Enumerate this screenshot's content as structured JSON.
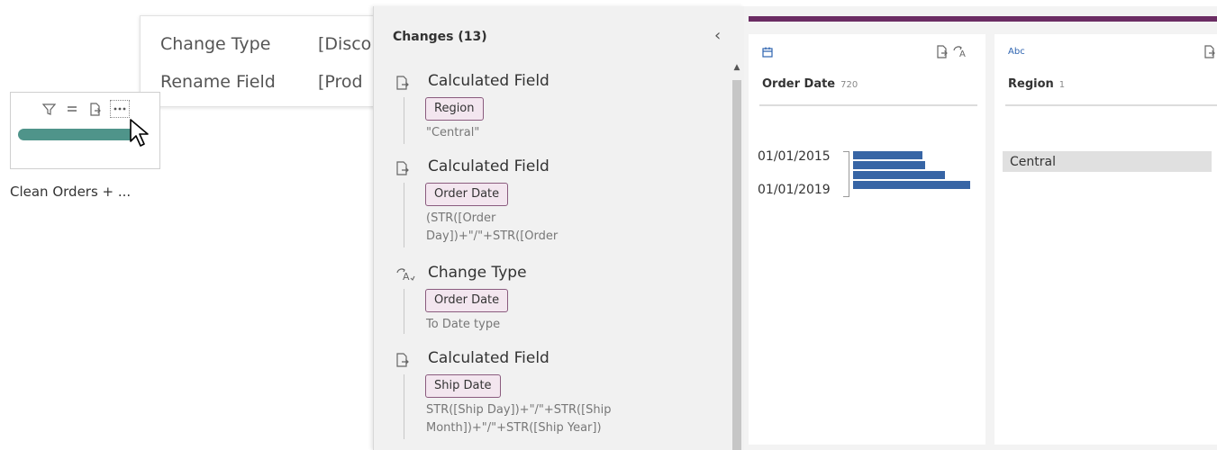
{
  "context_menu": {
    "items": [
      {
        "label": "Change Type",
        "value": "[Disco"
      },
      {
        "label": "Rename Field",
        "value": "[Prod"
      }
    ]
  },
  "flow_node": {
    "label": "Clean Orders + ...",
    "toolbar_icons": [
      "filter-icon",
      "equals-icon",
      "calculated-field-icon",
      "more-options-icon"
    ],
    "accent_color": "#4f948a"
  },
  "changes_panel": {
    "title": "Changes (13)",
    "collapse_glyph": "‹",
    "entries": [
      {
        "icon": "calculated-field-icon",
        "title": "Calculated Field",
        "field": "Region",
        "description": "\"Central\""
      },
      {
        "icon": "calculated-field-icon",
        "title": "Calculated Field",
        "field": "Order Date",
        "description": "(STR([Order\nDay])+\"/\"+STR([Order"
      },
      {
        "icon": "change-type-icon",
        "title": "Change Type",
        "field": "Order Date",
        "description": "To Date type"
      },
      {
        "icon": "calculated-field-icon",
        "title": "Calculated Field",
        "field": "Ship Date",
        "description": "STR([Ship Day])+\"/\"+STR([Ship\nMonth])+\"/\"+STR([Ship Year])"
      }
    ]
  },
  "profile": {
    "header_color": "#6b2c63",
    "cards": [
      {
        "type_label": "calendar-icon",
        "field_name": "Order Date",
        "count": "720",
        "axis_labels": [
          "01/01/2015",
          "01/01/2019"
        ],
        "histogram": [
          0.55,
          0.57,
          0.73,
          0.93
        ]
      },
      {
        "type_label": "Abc",
        "field_name": "Region",
        "count": "1",
        "values": [
          "Central"
        ]
      }
    ]
  }
}
